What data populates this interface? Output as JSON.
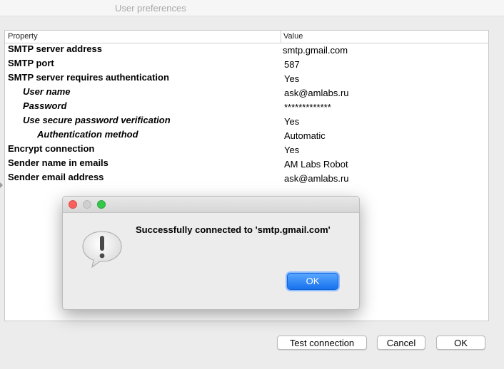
{
  "window": {
    "title": "User preferences"
  },
  "table": {
    "headers": {
      "property": "Property",
      "value": "Value"
    },
    "rows": [
      {
        "property": "SMTP server address",
        "value": "smtp.gmail.com"
      },
      {
        "property": "SMTP port",
        "value": "587"
      },
      {
        "property": "SMTP server requires authentication",
        "value": "Yes"
      },
      {
        "property": "User name",
        "value": "ask@amlabs.ru"
      },
      {
        "property": "Password",
        "value": "*************"
      },
      {
        "property": "Use secure password verification",
        "value": "Yes"
      },
      {
        "property": "Authentication method",
        "value": "Automatic"
      },
      {
        "property": "Encrypt connection",
        "value": "Yes"
      },
      {
        "property": "Sender name in emails",
        "value": "AM Labs Robot"
      },
      {
        "property": "Sender email address",
        "value": "ask@amlabs.ru"
      }
    ]
  },
  "buttons": {
    "test_connection": "Test connection",
    "cancel": "Cancel",
    "ok": "OK"
  },
  "dialog": {
    "message": "Successfully connected to 'smtp.gmail.com'",
    "ok_label": "OK",
    "icon": "alert-icon",
    "accent_color": "#1672ee"
  }
}
